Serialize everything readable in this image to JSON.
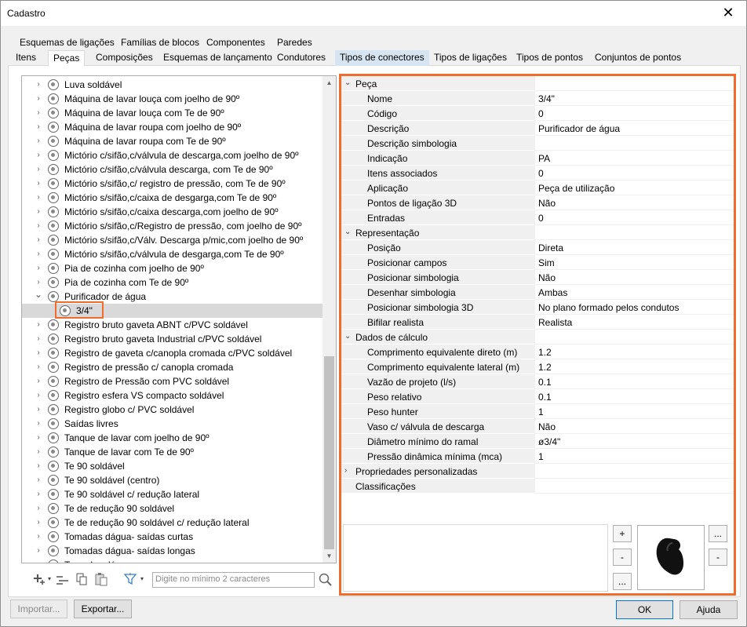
{
  "window": {
    "title": "Cadastro",
    "close": "✕"
  },
  "tabs_row1": [
    "Esquemas de ligações",
    "Famílias de blocos",
    "Componentes",
    "Paredes"
  ],
  "tabs_row2": [
    "Itens",
    "Peças",
    "Composições",
    "Esquemas de lançamento",
    "Condutores",
    "Tipos de conectores",
    "Tipos de ligações",
    "Tipos de pontos",
    "Conjuntos de pontos"
  ],
  "tree": {
    "items": [
      "Luva soldável",
      "Máquina de lavar louça com joelho de 90º",
      "Máquina de lavar louça com Te de 90º",
      "Máquina de lavar roupa com joelho de 90º",
      "Máquina de lavar roupa com Te de 90º",
      "Mictório c/sifão,c/válvula de descarga,com joelho de 90º",
      "Mictório c/sifão,c/válvula descarga, com Te de 90º",
      "Mictório s/sifão,c/ registro de pressão, com Te de 90º",
      "Mictório s/sifão,c/caixa de desgarga,com Te de 90º",
      "Mictório s/sifão,c/caixa descarga,com joelho de 90º",
      "Mictório s/sifão,c/Registro de pressão, com joelho de 90º",
      "Mictório s/sifão,c/Válv. Descarga p/mic,com joelho de 90º",
      "Mictório s/sifão,c/válvula de desgarga,com Te de 90º",
      "Pia de cozinha com joelho de 90º",
      "Pia de cozinha com Te de 90º",
      "Purificador de água",
      "3/4\"",
      "Registro bruto gaveta ABNT c/PVC soldável",
      "Registro bruto gaveta Industrial  c/PVC soldável",
      "Registro de gaveta c/canopla cromada c/PVC soldável",
      "Registro de pressão c/ canopla cromada",
      "Registro de Pressão com PVC soldável",
      "Registro esfera VS compacto soldável",
      "Registro globo c/ PVC soldável",
      "Saídas livres",
      "Tanque de lavar com joelho de 90º",
      "Tanque de lavar com Te de 90º",
      "Te 90 soldável",
      "Te 90 soldável (centro)",
      "Te 90 soldável c/ redução lateral",
      "Te de redução 90 soldável",
      "Te de redução 90 soldável c/ redução lateral",
      "Tomadas dágua- saídas curtas",
      "Tomadas dágua- saídas longas",
      "Tomadas dágua- ..."
    ],
    "search_placeholder": "Digite no mínimo 2 caracteres"
  },
  "properties": {
    "peca": {
      "label": "Peça",
      "rows": [
        [
          "Nome",
          "3/4\""
        ],
        [
          "Código",
          "0"
        ],
        [
          "Descrição",
          "Purificador de água"
        ],
        [
          "Descrição simbologia",
          ""
        ],
        [
          "Indicação",
          "PA"
        ],
        [
          "Itens associados",
          "0"
        ],
        [
          "Aplicação",
          "Peça de utilização"
        ],
        [
          "Pontos de ligação 3D",
          "Não"
        ],
        [
          "Entradas",
          "0"
        ]
      ]
    },
    "representacao": {
      "label": "Representação",
      "rows": [
        [
          "Posição",
          "Direta"
        ],
        [
          "Posicionar campos",
          "Sim"
        ],
        [
          "Posicionar simbologia",
          "Não"
        ],
        [
          "Desenhar simbologia",
          "Ambas"
        ],
        [
          "Posicionar simbologia 3D",
          "No plano formado pelos condutos"
        ],
        [
          "Bifilar realista",
          "Realista"
        ]
      ]
    },
    "calculo": {
      "label": "Dados de cálculo",
      "rows": [
        [
          "Comprimento equivalente direto (m)",
          "1.2"
        ],
        [
          "Comprimento equivalente lateral (m)",
          "1.2"
        ],
        [
          "Vazão de projeto (l/s)",
          "0.1"
        ],
        [
          "Peso relativo",
          "0.1"
        ],
        [
          "Peso hunter",
          "1"
        ],
        [
          "Vaso c/ válvula de descarga",
          "Não"
        ],
        [
          "Diâmetro mínimo do ramal",
          "ø3/4\""
        ],
        [
          "Pressão dinâmica mínima (mca)",
          "1"
        ]
      ]
    },
    "personalizadas": "Propriedades personalizadas",
    "classificacoes": "Classificações"
  },
  "side_buttons": {
    "plus": "+",
    "minus": "-",
    "more": "...",
    "more2": "...",
    "minus2": "-"
  },
  "footer": {
    "import": "Importar...",
    "export": "Exportar...",
    "ok": "OK",
    "help": "Ajuda"
  }
}
